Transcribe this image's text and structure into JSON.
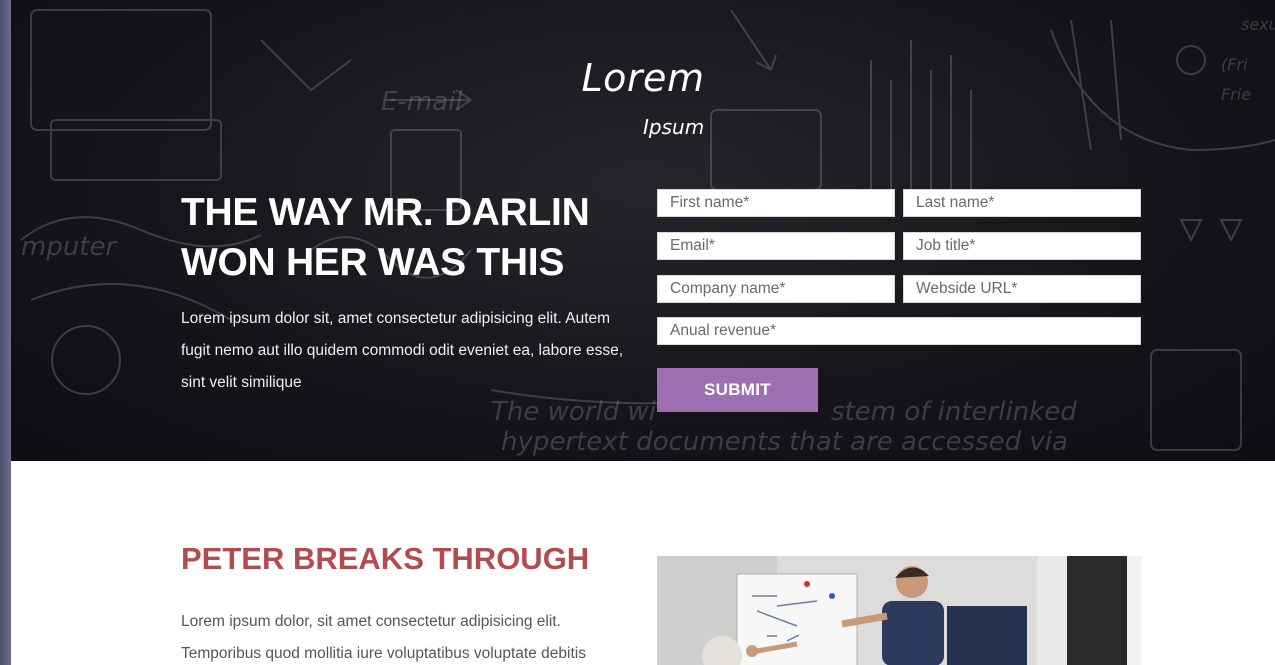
{
  "hero": {
    "brand_title": "Lorem",
    "brand_subtitle": "Ipsum",
    "headline": "THE WAY MR. DARLIN WON HER WAS THIS",
    "intro": "Lorem ipsum dolor sit, amet consectetur adipisicing elit. Autem fugit nemo aut illo quidem commodi odit eveniet ea, labore esse, sint velit similique"
  },
  "form": {
    "first_name_placeholder": "First name*",
    "last_name_placeholder": "Last name*",
    "email_placeholder": "Email*",
    "job_title_placeholder": "Job title*",
    "company_placeholder": "Company name*",
    "website_placeholder": "Webside URL*",
    "revenue_placeholder": "Anual revenue*",
    "submit_label": "SUBMIT"
  },
  "section": {
    "title": "PETER BREAKS THROUGH",
    "text": "Lorem ipsum dolor, sit amet consectetur adipisicing elit. Temporibus quod mollitia iure voluptatibus voluptate debitis"
  },
  "colors": {
    "accent_button": "#9e6fb0",
    "section_title": "#b24c4f",
    "hero_background": "#151519"
  },
  "icons": {
    "photo": "presentation-photo"
  }
}
